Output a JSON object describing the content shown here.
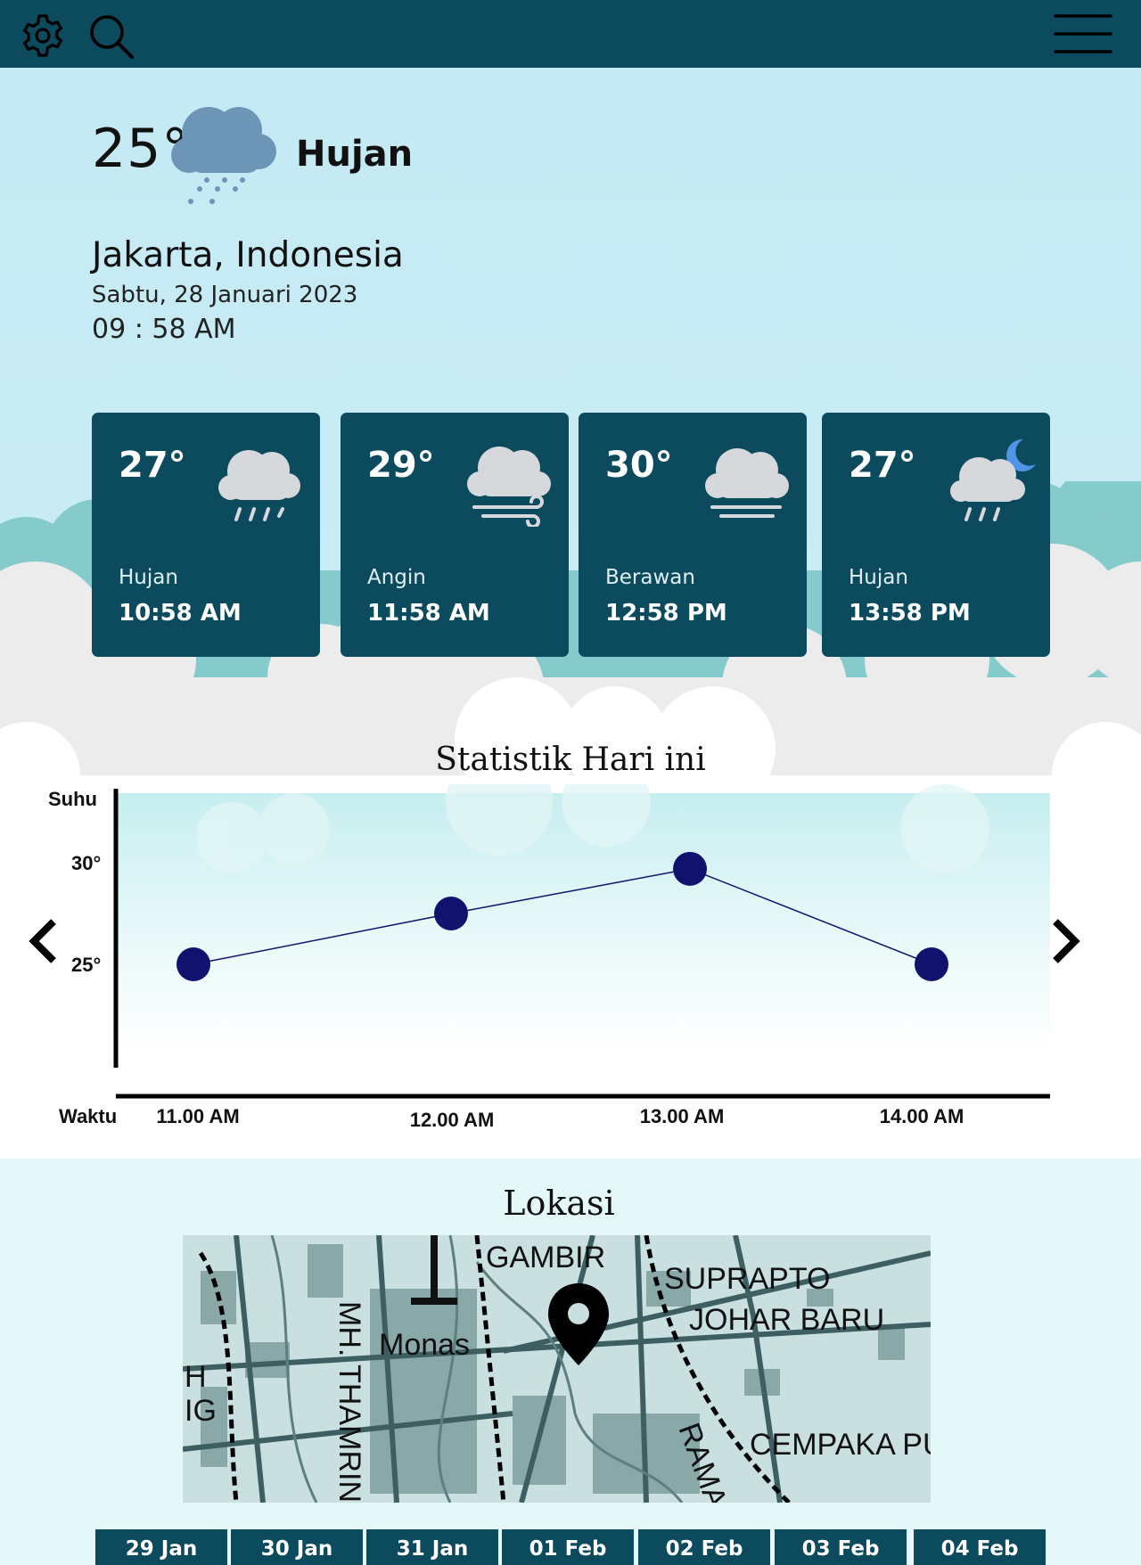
{
  "header": {
    "settings_icon": "gear-icon",
    "search_icon": "search-icon",
    "menu_icon": "hamburger-menu-icon",
    "bg_color": "#0c4a5e"
  },
  "current": {
    "temperature": "25°",
    "condition": "Hujan",
    "icon": "rain-cloud-icon",
    "location": "Jakarta, Indonesia",
    "date": "Sabtu, 28 Januari 2023",
    "time": "09 : 58 AM"
  },
  "forecast": [
    {
      "temp": "27°",
      "condition": "Hujan",
      "time": "10:58 AM",
      "icon": "rain-cloud-icon"
    },
    {
      "temp": "29°",
      "condition": "Angin",
      "time": "11:58 AM",
      "icon": "wind-cloud-icon"
    },
    {
      "temp": "30°",
      "condition": "Berawan",
      "time": "12:58 PM",
      "icon": "fog-cloud-icon"
    },
    {
      "temp": "27°",
      "condition": "Hujan",
      "time": "13:58 PM",
      "icon": "night-rain-cloud-icon"
    }
  ],
  "stats": {
    "title": "Statistik Hari ini",
    "prev_icon": "chevron-left-icon",
    "next_icon": "chevron-right-icon"
  },
  "chart_data": {
    "type": "line",
    "title": "Statistik Hari ini",
    "ylabel": "Suhu",
    "xlabel": "Waktu",
    "categories": [
      "11.00 AM",
      "12.00 AM",
      "13.00 AM",
      "14.00 AM"
    ],
    "yticks": [
      "30°",
      "25°"
    ],
    "values": [
      25,
      27.5,
      29.7,
      25
    ],
    "ylim": [
      20,
      33
    ],
    "color": "#11116e"
  },
  "location": {
    "title": "Lokasi",
    "pin_icon": "map-pin-icon",
    "map_labels": [
      "GAMBIR",
      "SUPRAPTO",
      "JOHAR BARU",
      "Monas",
      "MH. THAMRIN",
      "CEMPAKA PU",
      "RAMA",
      "H",
      "IG"
    ]
  },
  "days": [
    "29 Jan",
    "30 Jan",
    "31 Jan",
    "01 Feb",
    "02 Feb",
    "03 Feb",
    "04 Feb"
  ]
}
